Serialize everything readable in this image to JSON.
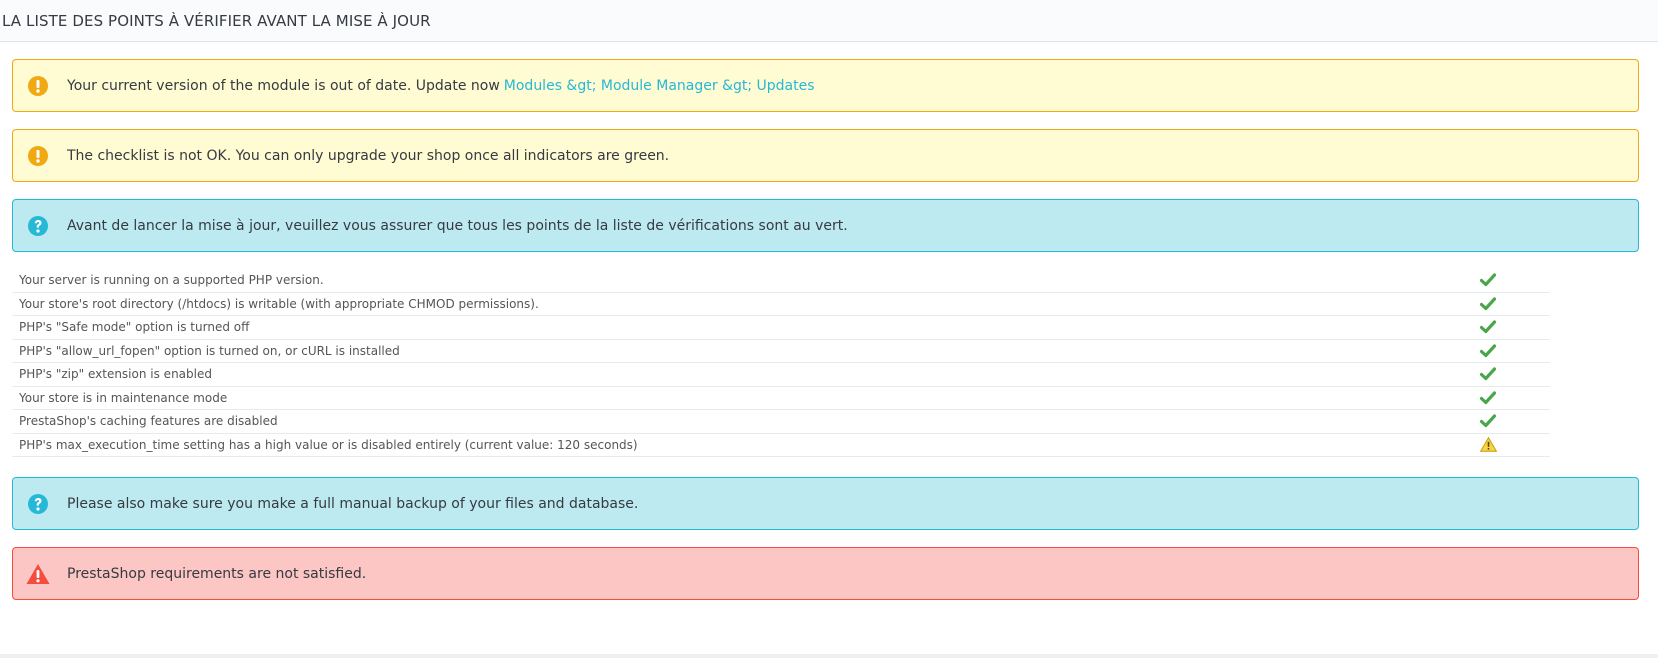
{
  "header": {
    "title": "LA LISTE DES POINTS À VÉRIFIER AVANT LA MISE À JOUR"
  },
  "alerts": {
    "outdated": {
      "text": "Your current version of the module is out of date. Update now",
      "link": "Modules &gt; Module Manager &gt; Updates"
    },
    "checklist_not_ok": {
      "text": "The checklist is not OK. You can only upgrade your shop once all indicators are green."
    },
    "info_green": {
      "text": "Avant de lancer la mise à jour, veuillez vous assurer que tous les points de la liste de vérifications sont au vert."
    },
    "backup": {
      "text": "Please also make sure you make a full manual backup of your files and database."
    },
    "requirements": {
      "text": "PrestaShop requirements are not satisfied."
    }
  },
  "checklist": [
    {
      "label": "Your server is running on a supported PHP version.",
      "status": "ok"
    },
    {
      "label": "Your store's root directory (/htdocs) is writable (with appropriate CHMOD permissions).",
      "status": "ok"
    },
    {
      "label": "PHP's \"Safe mode\" option is turned off",
      "status": "ok"
    },
    {
      "label": "PHP's \"allow_url_fopen\" option is turned on, or cURL is installed",
      "status": "ok"
    },
    {
      "label": "PHP's \"zip\" extension is enabled",
      "status": "ok"
    },
    {
      "label": "Your store is in maintenance mode",
      "status": "ok"
    },
    {
      "label": "PrestaShop's caching features are disabled",
      "status": "ok"
    },
    {
      "label": "PHP's max_execution_time setting has a high value or is disabled entirely (current value: 120 seconds)",
      "status": "warning"
    }
  ],
  "colors": {
    "warning_icon": "#f0a913",
    "info_icon": "#25b9d7",
    "danger_icon": "#f54c3e",
    "check_ok": "#4aa64b",
    "check_warning": "#e8b400"
  }
}
